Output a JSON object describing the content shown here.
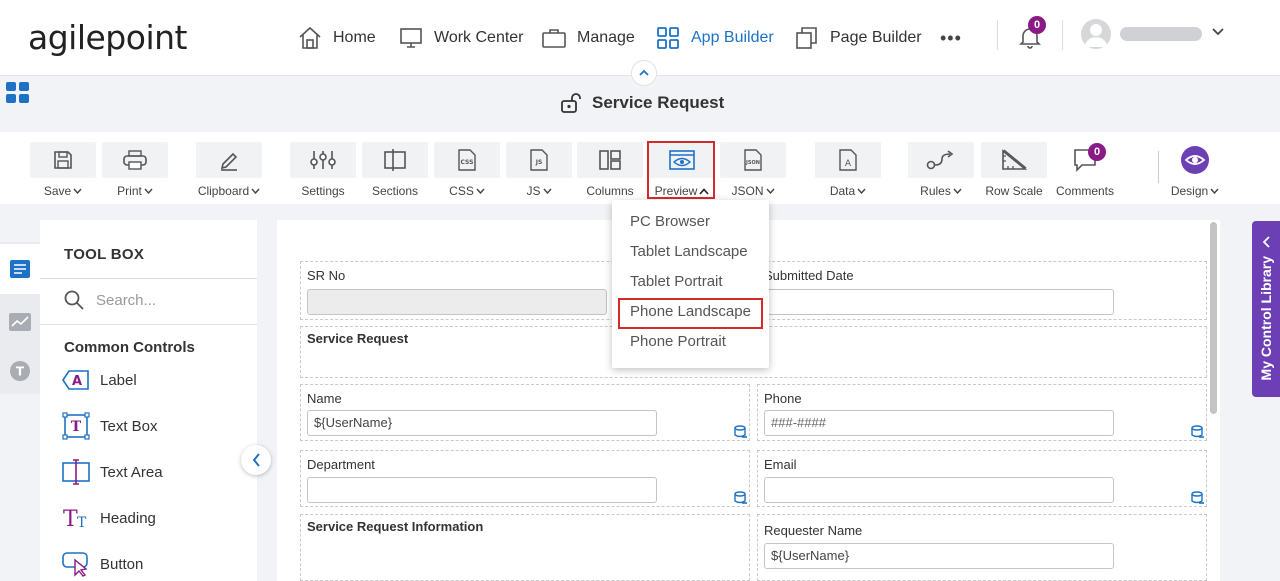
{
  "brand": {
    "logo": "agilepoint"
  },
  "nav": {
    "items": [
      {
        "label": "Home",
        "icon": "home-icon"
      },
      {
        "label": "Work Center",
        "icon": "monitor-icon"
      },
      {
        "label": "Manage",
        "icon": "briefcase-icon"
      },
      {
        "label": "App Builder",
        "icon": "grid-icon",
        "active": true
      },
      {
        "label": "Page Builder",
        "icon": "copy-icon"
      }
    ],
    "more": "•••",
    "notifications_count": "0"
  },
  "page": {
    "title": "Service Request"
  },
  "toolbar": {
    "items": [
      {
        "label": "Save",
        "icon": "save-icon",
        "caret": true
      },
      {
        "label": "Print",
        "icon": "print-icon",
        "caret": true
      },
      {
        "label": "Clipboard",
        "icon": "clipboard-icon",
        "caret": true
      },
      {
        "label": "Settings",
        "icon": "sliders-icon",
        "caret": false
      },
      {
        "label": "Sections",
        "icon": "sections-icon",
        "caret": false
      },
      {
        "label": "CSS",
        "icon": "css-icon",
        "caret": true
      },
      {
        "label": "JS",
        "icon": "js-icon",
        "caret": true
      },
      {
        "label": "Columns",
        "icon": "columns-icon",
        "caret": false
      },
      {
        "label": "Preview",
        "icon": "preview-icon",
        "caret": true,
        "open": true
      },
      {
        "label": "JSON",
        "icon": "json-icon",
        "caret": true
      },
      {
        "label": "Data",
        "icon": "data-icon",
        "caret": true
      },
      {
        "label": "Rules",
        "icon": "rules-icon",
        "caret": true
      },
      {
        "label": "Row Scale",
        "icon": "rowscale-icon",
        "caret": false
      },
      {
        "label": "Comments",
        "icon": "comment-icon",
        "caret": false,
        "badge": "0"
      },
      {
        "label": "Design",
        "icon": "eye-icon",
        "caret": true
      }
    ]
  },
  "preview_menu": {
    "items": [
      "PC Browser",
      "Tablet Landscape",
      "Tablet Portrait",
      "Phone Landscape",
      "Phone Portrait"
    ],
    "highlighted": "Phone Landscape"
  },
  "toolbox": {
    "title": "TOOL BOX",
    "search_placeholder": "Search...",
    "section": "Common Controls",
    "controls": [
      {
        "label": "Label",
        "icon": "label-icon"
      },
      {
        "label": "Text Box",
        "icon": "textbox-icon"
      },
      {
        "label": "Text Area",
        "icon": "textarea-icon"
      },
      {
        "label": "Heading",
        "icon": "heading-icon"
      },
      {
        "label": "Button",
        "icon": "button-icon"
      }
    ]
  },
  "form": {
    "sr_no": {
      "label": "SR No",
      "value": ""
    },
    "submitted_date": {
      "label": "Submitted Date",
      "value": ""
    },
    "section1": "Service Request",
    "name": {
      "label": "Name",
      "value": "${UserName}"
    },
    "phone": {
      "label": "Phone",
      "placeholder": "###-####"
    },
    "department": {
      "label": "Department",
      "value": ""
    },
    "email": {
      "label": "Email",
      "value": ""
    },
    "section2": "Service Request Information",
    "requester_name": {
      "label": "Requester Name",
      "value": "${UserName}"
    }
  },
  "control_library": {
    "label": "My Control Library"
  },
  "colors": {
    "accent": "#1d72c6",
    "brand_purple": "#6c3fb5",
    "badge": "#8a1b86",
    "highlight": "#d42a2a"
  }
}
